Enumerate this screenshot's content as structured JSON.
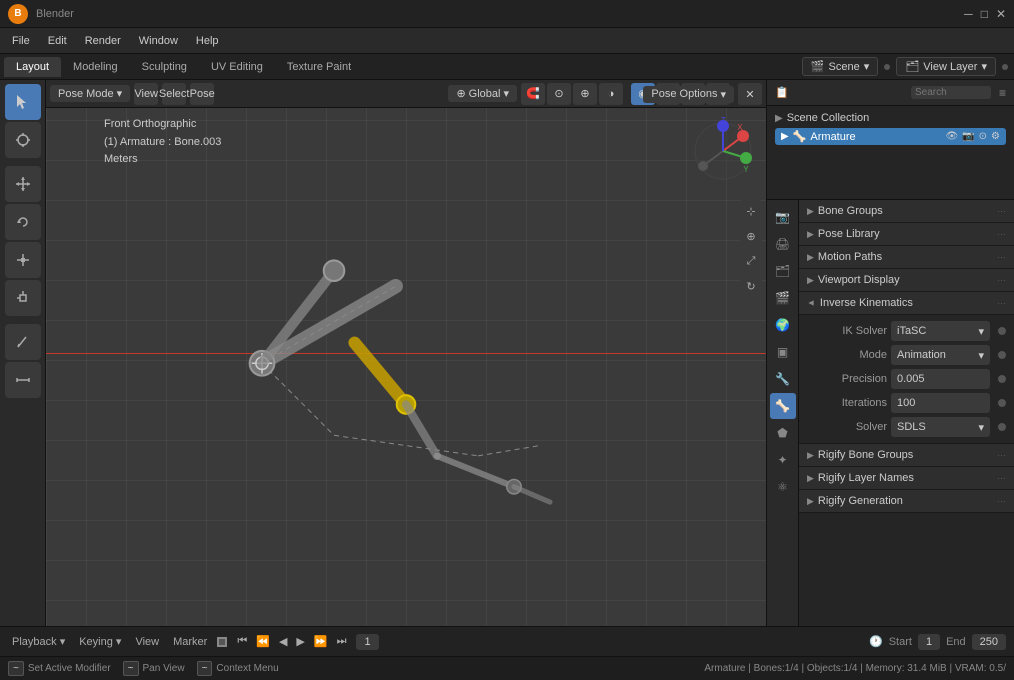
{
  "titlebar": {
    "logo": "B",
    "title": "Blender",
    "controls": [
      "─",
      "□",
      "✕"
    ]
  },
  "menubar": {
    "items": [
      "File",
      "Edit",
      "Render",
      "Window",
      "Help"
    ]
  },
  "workspacebar": {
    "tabs": [
      "Layout",
      "Modeling",
      "Sculpting",
      "UV Editing",
      "Texture Paint"
    ],
    "active": "Layout",
    "scene": "Scene",
    "view_layer": "View Layer"
  },
  "viewport": {
    "info_line1": "Front Orthographic",
    "info_line2": "(1) Armature : Bone.003",
    "info_line3": "Meters",
    "mode": "Pose Mode",
    "view": "View",
    "select": "Select",
    "pose": "Pose",
    "transform": "Global",
    "pose_options": "Pose Options"
  },
  "outliner": {
    "title": "Scene Collection",
    "armature_name": "Armature"
  },
  "properties": {
    "sections": [
      {
        "id": "bone-groups",
        "label": "Bone Groups",
        "open": false
      },
      {
        "id": "pose-library",
        "label": "Pose Library",
        "open": false
      },
      {
        "id": "motion-paths",
        "label": "Motion Paths",
        "open": false
      },
      {
        "id": "viewport-display",
        "label": "Viewport Display",
        "open": false
      },
      {
        "id": "inverse-kinematics",
        "label": "Inverse Kinematics",
        "open": true
      },
      {
        "id": "rigify-bone-groups",
        "label": "Rigify Bone Groups",
        "open": false
      },
      {
        "id": "rigify-layer-names",
        "label": "Rigify Layer Names",
        "open": false
      },
      {
        "id": "rigify-generation",
        "label": "Rigify Generation",
        "open": false
      }
    ],
    "ik": {
      "solver_label": "IK Solver",
      "solver_value": "iTaSC",
      "mode_label": "Mode",
      "mode_value": "Animation",
      "precision_label": "Precision",
      "precision_value": "0.005",
      "iterations_label": "Iterations",
      "iterations_value": "100",
      "solver2_label": "Solver",
      "solver2_value": "SDLS"
    }
  },
  "timeline": {
    "playback": "Playback",
    "keying": "Keying",
    "view": "View",
    "marker": "Marker",
    "frame": "1",
    "start_label": "Start",
    "start_value": "1",
    "end_label": "End",
    "end_value": "250"
  },
  "statusbar": {
    "item1_key": "~",
    "item1_text": "Set Active Modifier",
    "item2_key": "~",
    "item2_text": "Pan View",
    "item3_key": "~",
    "item3_text": "Context Menu",
    "info": "Armature | Bones:1/4 | Objects:1/4 | Memory: 31.4 MiB | VRAM: 0.5/"
  },
  "icons": {
    "chevron_right": "▶",
    "chevron_down": "▼",
    "eye": "👁",
    "camera": "📷",
    "dot": "●",
    "settings": "⚙",
    "move": "⊹",
    "rotate": "↻",
    "scale": "⤢",
    "cursor": "⊕",
    "transform": "✦",
    "annotate": "✏",
    "measure": "⟷",
    "plus": "+",
    "filter": "≡",
    "search": "🔍"
  }
}
